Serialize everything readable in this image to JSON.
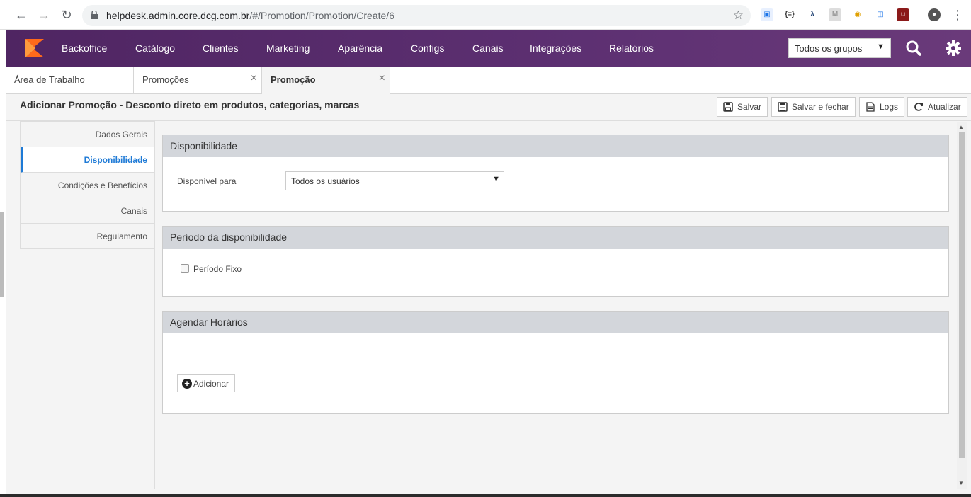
{
  "browser": {
    "url_host": "helpdesk.admin.core.dcg.com.br",
    "url_path": "/#/Promotion/Promotion/Create/6"
  },
  "topnav": {
    "menu": [
      "Backoffice",
      "Catálogo",
      "Clientes",
      "Marketing",
      "Aparência",
      "Configs",
      "Canais",
      "Integrações",
      "Relatórios"
    ],
    "group_select": "Todos os grupos",
    "brand_color": "#5c2d6e"
  },
  "tabs": [
    {
      "label": "Área de Trabalho"
    },
    {
      "label": "Promoções"
    },
    {
      "label": "Promoção"
    }
  ],
  "page": {
    "title": "Adicionar Promoção - Desconto direto em produtos, categorias, marcas",
    "toolbar": {
      "save": "Salvar",
      "save_close": "Salvar e fechar",
      "logs": "Logs",
      "refresh": "Atualizar"
    }
  },
  "side_menu": [
    "Dados Gerais",
    "Disponibilidade",
    "Condições e Benefícios",
    "Canais",
    "Regulamento"
  ],
  "panels": {
    "availability": {
      "title": "Disponibilidade",
      "label": "Disponível para",
      "value": "Todos os usuários"
    },
    "period": {
      "title": "Período da disponibilidade",
      "checkbox_label": "Período Fixo"
    },
    "schedule": {
      "title": "Agendar Horários",
      "add_label": "Adicionar"
    }
  }
}
